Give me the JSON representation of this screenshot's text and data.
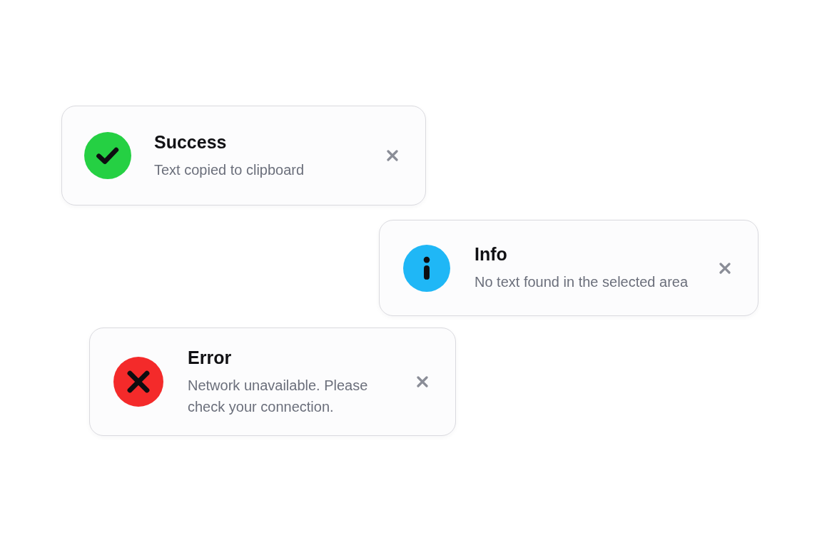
{
  "toasts": [
    {
      "kind": "success",
      "color": "#25d043",
      "title": "Success",
      "message": "Text copied to clipboard"
    },
    {
      "kind": "info",
      "color": "#1fb7f6",
      "title": "Info",
      "message": "No text found in the selected area"
    },
    {
      "kind": "error",
      "color": "#f42a2a",
      "title": "Error",
      "message": "Network unavailable. Please check your connection."
    }
  ]
}
